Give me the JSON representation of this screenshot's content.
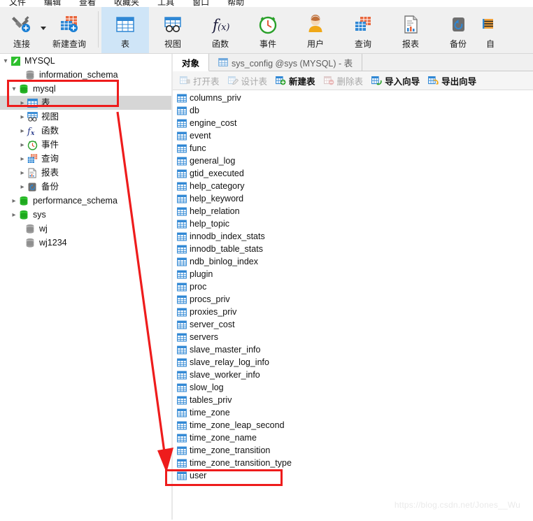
{
  "menu": {
    "items": [
      "文件",
      "编辑",
      "查看",
      "收藏夹",
      "工具",
      "窗口",
      "帮助"
    ]
  },
  "toolbar": {
    "items": [
      {
        "label": "连接",
        "icon": "connection-icon",
        "active": false,
        "has_dropdown": true
      },
      {
        "label": "新建查询",
        "icon": "new-query-icon",
        "active": false,
        "has_dropdown": false
      },
      {
        "label": "表",
        "icon": "table-icon",
        "active": true,
        "has_dropdown": false
      },
      {
        "label": "视图",
        "icon": "view-icon",
        "active": false,
        "has_dropdown": false
      },
      {
        "label": "函数",
        "icon": "function-icon",
        "active": false,
        "has_dropdown": false
      },
      {
        "label": "事件",
        "icon": "event-clock-icon",
        "active": false,
        "has_dropdown": false
      },
      {
        "label": "用户",
        "icon": "user-icon",
        "active": false,
        "has_dropdown": false
      },
      {
        "label": "查询",
        "icon": "query-icon",
        "active": false,
        "has_dropdown": false
      },
      {
        "label": "报表",
        "icon": "report-icon",
        "active": false,
        "has_dropdown": false
      },
      {
        "label": "备份",
        "icon": "backup-icon",
        "active": false,
        "has_dropdown": false
      },
      {
        "label": "自",
        "icon": "automation-icon",
        "active": false,
        "has_dropdown": false
      }
    ]
  },
  "sidebar": {
    "items": [
      {
        "label": "MYSQL",
        "indent": 0,
        "icon": "navicat-connection-icon",
        "twisty": "expanded",
        "selected": false
      },
      {
        "label": "information_schema",
        "indent": 1,
        "icon": "db-gray-icon",
        "twisty": "none",
        "selected": false
      },
      {
        "label": "mysql",
        "indent": 1,
        "icon": "db-green-icon",
        "twisty": "expanded",
        "selected": false
      },
      {
        "label": "表",
        "indent": 2,
        "icon": "table-icon",
        "twisty": "collapsed",
        "selected": true
      },
      {
        "label": "视图",
        "indent": 2,
        "icon": "view-icon",
        "twisty": "collapsed",
        "selected": false
      },
      {
        "label": "函数",
        "indent": 2,
        "icon": "function-icon",
        "twisty": "collapsed",
        "selected": false
      },
      {
        "label": "事件",
        "indent": 2,
        "icon": "event-clock-icon",
        "twisty": "collapsed",
        "selected": false
      },
      {
        "label": "查询",
        "indent": 2,
        "icon": "query-icon",
        "twisty": "collapsed",
        "selected": false
      },
      {
        "label": "报表",
        "indent": 2,
        "icon": "report-icon",
        "twisty": "collapsed",
        "selected": false
      },
      {
        "label": "备份",
        "indent": 2,
        "icon": "backup-icon",
        "twisty": "collapsed",
        "selected": false
      },
      {
        "label": "performance_schema",
        "indent": 1,
        "icon": "db-green-icon",
        "twisty": "collapsed",
        "selected": false
      },
      {
        "label": "sys",
        "indent": 1,
        "icon": "db-green-icon",
        "twisty": "collapsed",
        "selected": false
      },
      {
        "label": "wj",
        "indent": 1,
        "icon": "db-gray-icon",
        "twisty": "none",
        "selected": false
      },
      {
        "label": "wj1234",
        "indent": 1,
        "icon": "db-gray-icon",
        "twisty": "none",
        "selected": false
      }
    ]
  },
  "right_panel": {
    "tabs": [
      {
        "label": "对象",
        "icon": "none",
        "current": true
      },
      {
        "label": "sys_config @sys (MYSQL) - 表",
        "icon": "table-icon",
        "current": false
      }
    ],
    "object_toolbar": [
      {
        "label": "打开表",
        "icon": "open-table-icon",
        "enabled": false
      },
      {
        "label": "设计表",
        "icon": "design-table-icon",
        "enabled": false
      },
      {
        "label": "新建表",
        "icon": "new-table-icon",
        "enabled": true
      },
      {
        "label": "删除表",
        "icon": "delete-table-icon",
        "enabled": false
      },
      {
        "label": "导入向导",
        "icon": "import-wizard-icon",
        "enabled": true
      },
      {
        "label": "导出向导",
        "icon": "export-wizard-icon",
        "enabled": true
      }
    ],
    "tables": [
      "columns_priv",
      "db",
      "engine_cost",
      "event",
      "func",
      "general_log",
      "gtid_executed",
      "help_category",
      "help_keyword",
      "help_relation",
      "help_topic",
      "innodb_index_stats",
      "innodb_table_stats",
      "ndb_binlog_index",
      "plugin",
      "proc",
      "procs_priv",
      "proxies_priv",
      "server_cost",
      "servers",
      "slave_master_info",
      "slave_relay_log_info",
      "slave_worker_info",
      "slow_log",
      "tables_priv",
      "time_zone",
      "time_zone_leap_second",
      "time_zone_name",
      "time_zone_transition",
      "time_zone_transition_type",
      "user"
    ]
  },
  "annotations": {
    "color": "#ee1c1c",
    "highlight_boxes": [
      "mysql-and-tables-node",
      "user-table-row"
    ],
    "arrow": "red-arrow-from-tables-node-to-user-table"
  },
  "watermark": {
    "text": "https://blog.csdn.net/Jones__Wu",
    "color": "#eaeaea"
  }
}
